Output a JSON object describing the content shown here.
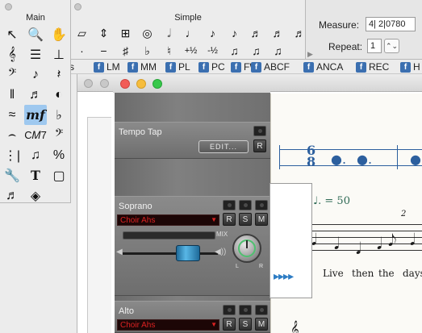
{
  "main_palette": {
    "title": "Main",
    "tools": [
      {
        "name": "selection-tool",
        "glyph": "↖"
      },
      {
        "name": "zoom-tool",
        "glyph": "🔍"
      },
      {
        "name": "hand-tool",
        "glyph": "✋"
      },
      {
        "name": "staff-tool",
        "glyph": "𝄞"
      },
      {
        "name": "key-signature-tool",
        "glyph": "☰"
      },
      {
        "name": "time-signature-tool",
        "glyph": "⊥"
      },
      {
        "name": "clef-tool",
        "glyph": "𝄢"
      },
      {
        "name": "note-tool",
        "glyph": "♪"
      },
      {
        "name": "rest-tool",
        "glyph": "𝄽"
      },
      {
        "name": "measure-tool",
        "glyph": "‖"
      },
      {
        "name": "tuplet-tool",
        "glyph": "♬"
      },
      {
        "name": "midi-tool",
        "glyph": "◐"
      },
      {
        "name": "hairpin-tool",
        "glyph": "≈"
      },
      {
        "name": "expression-tool",
        "glyph": "mf"
      },
      {
        "name": "articulation-tool",
        "glyph": "♭"
      },
      {
        "name": "tie-tool",
        "glyph": "⌢"
      },
      {
        "name": "chord-tool",
        "glyph": "C𝑀7"
      },
      {
        "name": "bass-tool",
        "glyph": "𝄢"
      },
      {
        "name": "repeat-tool",
        "glyph": "⋮|"
      },
      {
        "name": "mirror-tool",
        "glyph": "♫"
      },
      {
        "name": "percent-tool",
        "glyph": "%"
      },
      {
        "name": "special-tools-icon",
        "glyph": "🔧"
      },
      {
        "name": "text-tool",
        "glyph": "T"
      },
      {
        "name": "page-layout-tool",
        "glyph": "▢"
      },
      {
        "name": "lyrics-tool",
        "glyph": "♬"
      },
      {
        "name": "graphics-tool",
        "glyph": "◈"
      }
    ]
  },
  "simple_palette": {
    "title": "Simple",
    "row1": [
      "▱",
      "⇕",
      "⊞",
      "◎",
      "𝅗𝅥",
      "♩",
      "♪",
      "♪",
      "♬",
      "♬",
      "♬"
    ],
    "row2": [
      "·",
      "−",
      "♯",
      "♭",
      "♮",
      "+½",
      "-½",
      "♫",
      "♫",
      "♫"
    ]
  },
  "measure_panel": {
    "measure_label": "Measure:",
    "measure_value": "4| 2|0780",
    "repeat_label": "Repeat:",
    "repeat_value": "1",
    "stepper": "⌃⌄"
  },
  "tags_bar": [
    "s",
    "LM",
    "MM",
    "PL",
    "PC",
    "FW",
    "ABCF",
    "ANCA",
    "REC",
    "H"
  ],
  "mixer": {
    "tempo_label": "Tempo Tap",
    "edit_label": "EDIT...",
    "r_label": "R",
    "soprano": {
      "name": "Soprano",
      "instrument": "Choir Ahs"
    },
    "alto": {
      "name": "Alto",
      "instrument": "Choir Ahs"
    },
    "rsm": [
      "R",
      "S",
      "M"
    ],
    "mix_label": "MIX",
    "knob_left": "L",
    "knob_right": "R",
    "arrows": "▸▸▸▸"
  },
  "score": {
    "time_sig_top": "6",
    "time_sig_bottom": "8",
    "tempo_mark": "♩. = 50",
    "measure_number": "2",
    "lyrics": [
      "Live",
      "then",
      "the",
      "days"
    ]
  }
}
